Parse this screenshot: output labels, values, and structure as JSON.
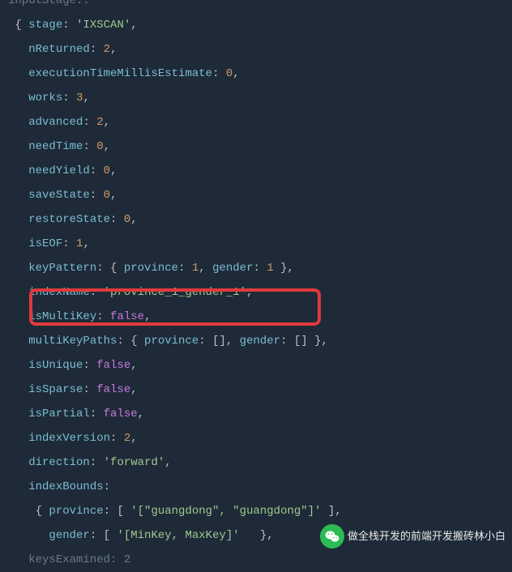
{
  "code": {
    "line0": "inputStage:",
    "open_brace": "{ ",
    "stage_k": "stage",
    "stage_v": "'IXSCAN'",
    "nReturned_k": "nReturned",
    "nReturned_v": "2",
    "etme_k": "executionTimeMillisEstimate",
    "etme_v": "0",
    "works_k": "works",
    "works_v": "3",
    "advanced_k": "advanced",
    "advanced_v": "2",
    "needTime_k": "needTime",
    "needTime_v": "0",
    "needYield_k": "needYield",
    "needYield_v": "0",
    "saveState_k": "saveState",
    "saveState_v": "0",
    "restoreState_k": "restoreState",
    "restoreState_v": "0",
    "isEOF_k": "isEOF",
    "isEOF_v": "1",
    "keyPattern_k": "keyPattern",
    "kp_prov_k": "province",
    "kp_prov_v": "1",
    "kp_gender_k": "gender",
    "kp_gender_v": "1",
    "indexName_k": "indexName",
    "indexName_v": "'province_1_gender_1'",
    "isMultiKey_k": "isMultiKey",
    "isMultiKey_v": "false",
    "multiKeyPaths_k": "multiKeyPaths",
    "mkp_prov_k": "province",
    "mkp_gender_k": "gender",
    "isUnique_k": "isUnique",
    "isUnique_v": "false",
    "isSparse_k": "isSparse",
    "isSparse_v": "false",
    "isPartial_k": "isPartial",
    "isPartial_v": "false",
    "indexVersion_k": "indexVersion",
    "indexVersion_v": "2",
    "direction_k": "direction",
    "direction_v": "'forward'",
    "indexBounds_k": "indexBounds",
    "ib_prov_k": "province",
    "ib_prov_v": "'[\"guangdong\", \"guangdong\"]'",
    "ib_gender_k": "gender",
    "ib_gender_v": "'[MinKey, MaxKey]'",
    "keysExamined_k": "keysExamined",
    "keysExamined_v": "2"
  },
  "watermark": {
    "text": "做全栈开发的前端开发搬砖林小白"
  }
}
